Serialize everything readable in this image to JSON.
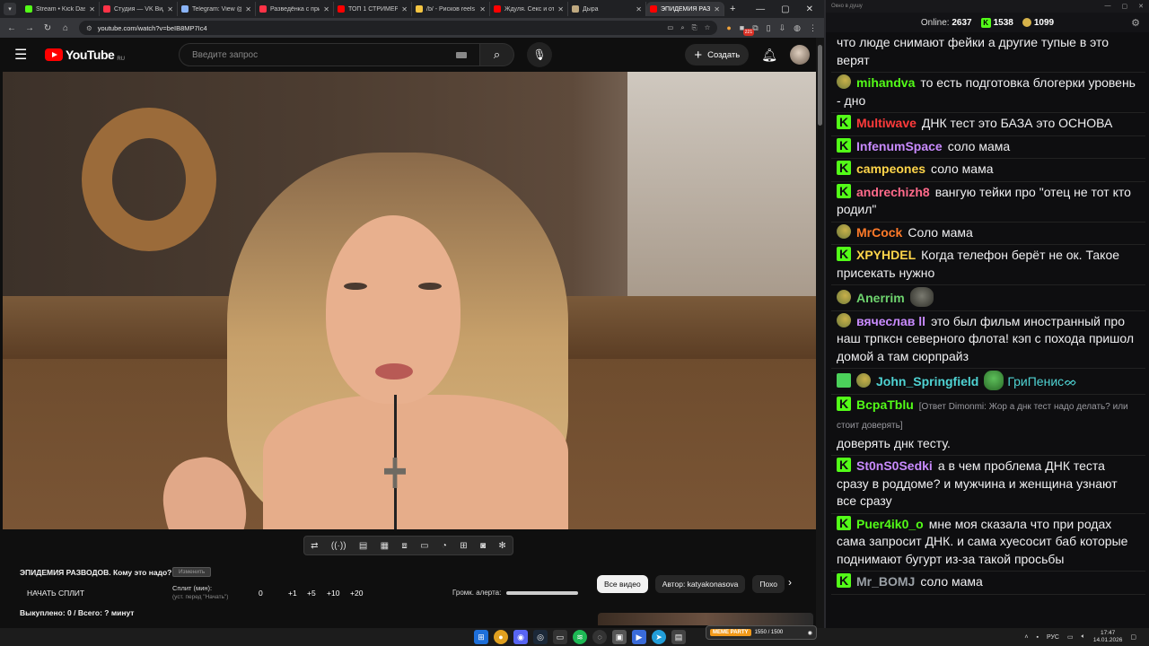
{
  "browser": {
    "tabs": [
      {
        "title": "Stream • Kick Dash",
        "color": "#53fc18"
      },
      {
        "title": "Студия — VK Виде",
        "color": "#ff3347"
      },
      {
        "title": "Telegram: View @F",
        "color": "#8ab4f8"
      },
      {
        "title": "Разведёнка с при",
        "color": "#ff3347"
      },
      {
        "title": "ТОП 1 СТРИМЕР В",
        "color": "#ff0000"
      },
      {
        "title": "/b/ - Рисков reels",
        "color": "#f4c542"
      },
      {
        "title": "Ждуля. Секс и от",
        "color": "#ff0000"
      },
      {
        "title": "Дырa",
        "color": "#bfa980"
      },
      {
        "title": "ЭПИДЕМИЯ РАЗВ",
        "color": "#ff0000",
        "active": true
      }
    ],
    "url": "youtube.com/watch?v=beIB8MP7Ic4",
    "ext_badge": "221"
  },
  "youtube": {
    "logo": "YouTube",
    "country": "RU",
    "search_placeholder": "Введите запрос",
    "create_label": "Создать"
  },
  "split_panel": {
    "title": "ЭПИДЕМИЯ РАЗВОДОВ. Кому это надо?",
    "edit_label": "Изменить",
    "start_label": "НАЧАТЬ СПЛИТ",
    "split_label": "Сплит (мин):",
    "split_hint": "(уст. перед \"Начать\")",
    "split_value": "0",
    "increments": [
      "+1",
      "+5",
      "+10",
      "+20"
    ],
    "bought": "Выкуплено: 0 / Всего: ? минут",
    "volume_label": "Громк. алерта:"
  },
  "chips": [
    "Все видео",
    "Автор: katyakonasova",
    "Похо"
  ],
  "chat": {
    "title": "Окно в душу",
    "online_label": "Online:",
    "online": "2637",
    "kick_count": "1538",
    "gold_count": "1099",
    "messages": [
      {
        "type": "cont",
        "user": "",
        "color": "#fff",
        "text": "что люде снимают фейки а другие тупые в это верят"
      },
      {
        "type": "pepe",
        "user": "mihandva",
        "color": "#53fc18",
        "text": "то есть подготовка блогерки уровень - дно"
      },
      {
        "type": "k",
        "user": "Multiwave",
        "color": "#ff3b3b",
        "text": "ДНК тест это БАЗА это ОСНОВА"
      },
      {
        "type": "k",
        "user": "InfenumSpace",
        "color": "#c98bff",
        "text": "соло мама"
      },
      {
        "type": "k",
        "user": "campeones",
        "color": "#ffd54a",
        "text": "соло мама"
      },
      {
        "type": "k",
        "user": "andrechizh8",
        "color": "#ff6a8a",
        "text": "вангую тейки про \"отец не тот кто родил\""
      },
      {
        "type": "pepe",
        "user": "MrCock",
        "color": "#ff7a29",
        "text": "Соло мама"
      },
      {
        "type": "k",
        "user": "XPYHDEL",
        "color": "#ffd54a",
        "text": "Когда телефон берёт не ок. Такое присекать нужно"
      },
      {
        "type": "pepe_emote",
        "user": "Anerrim",
        "color": "#6ed36e",
        "text": ""
      },
      {
        "type": "pepe",
        "user": "вячеслав ll",
        "color": "#c98bff",
        "text": "это был фильм иностранный про наш трпксн северного флота! кэп с похода пришол домой а там сюрпрайз"
      },
      {
        "type": "check",
        "user": "John_Springfield",
        "color": "#4fd3d3",
        "text": "ГриПенисᨖ"
      },
      {
        "type": "reply",
        "user": "BcpaTblu",
        "color": "#53fc18",
        "reply": "[Ответ Dimonmi: Жор а днк тест надо делать? или стоит доверять]",
        "text": "доверять днк тесту."
      },
      {
        "type": "k",
        "user": "St0nS0Sedki",
        "color": "#c98bff",
        "text": "а в чем проблема ДНК теста сразу в роддоме? и мужчина и женщина узнают все сразу"
      },
      {
        "type": "k",
        "user": "Puer4ik0_o",
        "color": "#53fc18",
        "text": "мне моя сказала что при родах сама запросит ДНК. и сама хуесосит баб которые поднимают бугурт из-за такой просьбы"
      },
      {
        "type": "k",
        "user": "Mr_BOMJ",
        "color": "#9aa0a6",
        "text": "соло мама"
      }
    ]
  },
  "taskbar": {
    "widget_label": "MEME PARTY",
    "widget_value": "1550 / 1500",
    "lang": "РУС",
    "time": "17:47",
    "date": "14.01.2026"
  }
}
